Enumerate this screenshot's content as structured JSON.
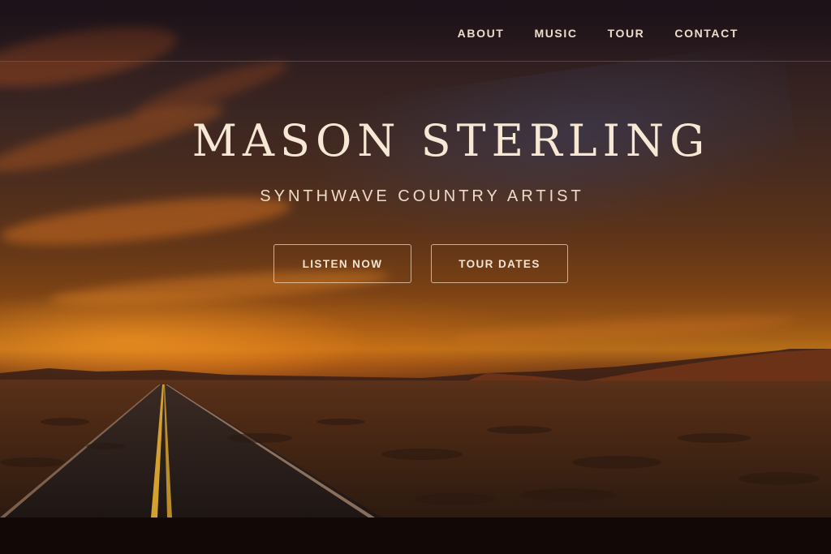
{
  "nav": {
    "items": [
      {
        "label": "ABOUT"
      },
      {
        "label": "MUSIC"
      },
      {
        "label": "TOUR"
      },
      {
        "label": "CONTACT"
      }
    ]
  },
  "hero": {
    "title": "MASON STERLING",
    "tagline": "SYNTHWAVE COUNTRY ARTIST",
    "buttons": {
      "listen": "LISTEN NOW",
      "tour": "TOUR DATES"
    }
  },
  "colors": {
    "text_primary": "#f6e8d4",
    "accent_sunset": "#b66d18",
    "background_dark": "#120907"
  },
  "icons": {
    "background": "desert-highway-sunset-image"
  }
}
